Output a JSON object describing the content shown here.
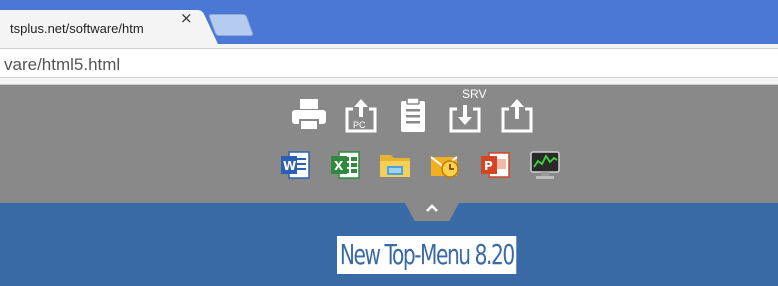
{
  "browser": {
    "tab_title": "tsplus.net/software/htm",
    "tab_close": "×",
    "address": "vare/html5.html"
  },
  "topmenu": {
    "tools": [
      {
        "name": "print-icon"
      },
      {
        "name": "upload-pc-icon",
        "badge": "PC"
      },
      {
        "name": "clipboard-icon"
      },
      {
        "name": "download-server-icon"
      },
      {
        "name": "upload-icon"
      }
    ],
    "srv_label": "SRV",
    "apps": [
      {
        "name": "word-icon",
        "color": "#2b5fb3"
      },
      {
        "name": "excel-icon",
        "color": "#2f8a3e"
      },
      {
        "name": "file-explorer-icon",
        "color": "#e6b32e"
      },
      {
        "name": "outlook-icon",
        "color": "#f0b020"
      },
      {
        "name": "powerpoint-icon",
        "color": "#d24625"
      },
      {
        "name": "task-manager-icon",
        "color": "#3d8a3d"
      }
    ]
  },
  "caption": "New Top-Menu 8.20",
  "colors": {
    "tabstrip": "#4a78d4",
    "menu_bg": "#898989",
    "page_bg": "#3a6aa6"
  }
}
